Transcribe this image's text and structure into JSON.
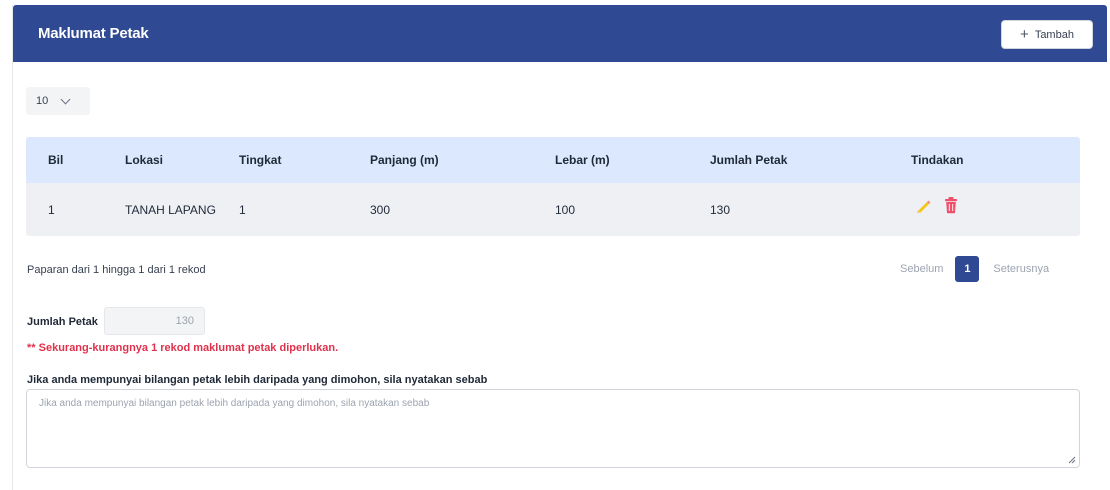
{
  "header": {
    "title": "Maklumat Petak",
    "add_label": "Tambah"
  },
  "page_size": {
    "value": "10"
  },
  "table": {
    "columns": [
      "Bil",
      "Lokasi",
      "Tingkat",
      "Panjang (m)",
      "Lebar (m)",
      "Jumlah Petak",
      "Tindakan"
    ],
    "rows": [
      {
        "bil": "1",
        "lokasi": "TANAH LAPANG",
        "tingkat": "1",
        "panjang": "300",
        "lebar": "100",
        "jumlah": "130"
      }
    ],
    "action_icons": [
      "edit-pencil-icon",
      "delete-trash-icon"
    ]
  },
  "pagination": {
    "info": "Paparan dari 1 hingga 1 dari 1 rekod",
    "prev_label": "Sebelum",
    "current_page": "1",
    "next_label": "Seterusnya"
  },
  "form": {
    "jumlah_label": "Jumlah Petak",
    "jumlah_value": "130",
    "error": "** Sekurang-kurangnya 1 rekod maklumat petak diperlukan.",
    "textarea_label": "Jika anda mempunyai bilangan petak lebih daripada yang dimohon, sila nyatakan sebab",
    "textarea_placeholder": "Jika anda mempunyai bilangan petak lebih daripada yang dimohon, sila nyatakan sebab"
  },
  "colors": {
    "header": "#2f4a93",
    "table_head": "#dbe8fd",
    "error": "#e0314c",
    "edit": "#f5c518",
    "delete": "#ef4f6a"
  }
}
